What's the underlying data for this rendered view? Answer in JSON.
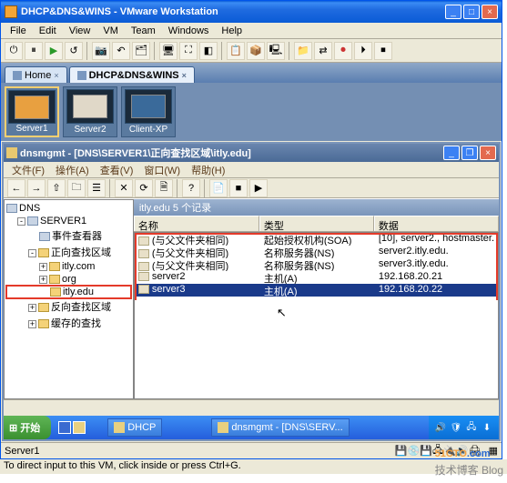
{
  "outer_title": "DHCP&DNS&WINS - VMware Workstation",
  "outer_menu": [
    "File",
    "Edit",
    "View",
    "VM",
    "Team",
    "Windows",
    "Help"
  ],
  "tabs": [
    {
      "label": "Home",
      "active": false
    },
    {
      "label": "DHCP&DNS&WINS",
      "active": true
    }
  ],
  "thumbs": [
    {
      "label": "Server1",
      "active": true
    },
    {
      "label": "Server2",
      "active": false
    },
    {
      "label": "Client-XP",
      "active": false
    }
  ],
  "inner_title": "dnsmgmt - [DNS\\SERVER1\\正向查找区域\\itly.edu]",
  "inner_menu": [
    "文件(F)",
    "操作(A)",
    "查看(V)",
    "窗口(W)",
    "帮助(H)"
  ],
  "tree": {
    "root": "DNS",
    "server": "SERVER1",
    "nodes": [
      {
        "tw": "",
        "icon": "srv",
        "label": "事件查看器",
        "indent": 2
      },
      {
        "tw": "-",
        "icon": "fld",
        "label": "正向查找区域",
        "indent": 2
      },
      {
        "tw": "+",
        "icon": "fld",
        "label": "itly.com",
        "indent": 3
      },
      {
        "tw": "+",
        "icon": "fld",
        "label": "org",
        "indent": 3
      },
      {
        "tw": "",
        "icon": "fld",
        "label": "itly.edu",
        "indent": 3,
        "hl": true
      },
      {
        "tw": "+",
        "icon": "fld",
        "label": "反向查找区域",
        "indent": 2
      },
      {
        "tw": "+",
        "icon": "fld",
        "label": "缓存的查找",
        "indent": 2
      }
    ]
  },
  "column_header": "itly.edu   5 个记录",
  "list_headers": [
    "名称",
    "类型",
    "数据"
  ],
  "rows": [
    {
      "c1": "(与父文件夹相同)",
      "c2": "起始授权机构(SOA)",
      "c3": "[10], server2., hostmaster."
    },
    {
      "c1": "(与父文件夹相同)",
      "c2": "名称服务器(NS)",
      "c3": "server2.itly.edu."
    },
    {
      "c1": "(与父文件夹相同)",
      "c2": "名称服务器(NS)",
      "c3": "server3.itly.edu."
    },
    {
      "c1": "server2",
      "c2": "主机(A)",
      "c3": "192.168.20.21"
    },
    {
      "c1": "server3",
      "c2": "主机(A)",
      "c3": "192.168.20.22",
      "sel": true
    }
  ],
  "outer_status": "Server1",
  "taskbar": {
    "start": "开始",
    "buttons": [
      {
        "label": "DHCP"
      },
      {
        "label": "dnsmgmt - [DNS\\SERV..."
      }
    ]
  },
  "bottom_status": "To direct input to this VM, click inside or press Ctrl+G.",
  "watermark": {
    "l1a": "51CTO",
    "l1b": ".com",
    "l2": "技术博客 Blog"
  }
}
